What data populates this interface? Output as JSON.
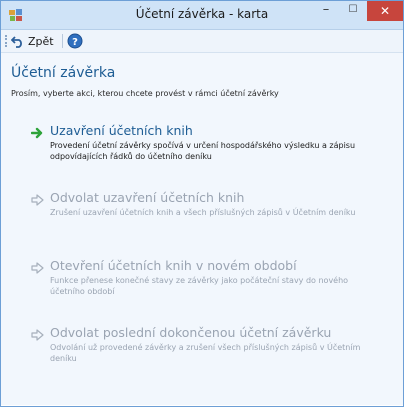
{
  "window": {
    "title": "Účetní závěrka - karta",
    "minimize_symbol": "–",
    "maximize_symbol": "☐",
    "close_symbol": "✕"
  },
  "toolbar": {
    "back_label": "Zpět",
    "back_icon": "undo-arrow-icon",
    "help_icon": "help-icon"
  },
  "page": {
    "title": "Účetní závěrka",
    "subtitle": "Prosím, vyberte akci, kterou chcete provést v rámci účetní závěrky"
  },
  "actions": [
    {
      "title": "Uzavření účetních knih",
      "description": "Provedení účetní závěrky spočívá v určení hospodářského výsledku a zápisu odpovídajících řádků do účetního deníku",
      "enabled": true,
      "icon": "green-arrow-icon"
    },
    {
      "title": "Odvolat uzavření účetních knih",
      "description": "Zrušení uzavření účetních knih a všech příslušných zápisů v Účetním deníku",
      "enabled": false,
      "icon": "gray-arrow-icon"
    },
    {
      "title": "Otevření účetních knih v novém období",
      "description": "Funkce přenese konečné stavy ze závěrky jako počáteční stavy do nového účetního období",
      "enabled": false,
      "icon": "gray-arrow-icon"
    },
    {
      "title": "Odvolat poslední dokončenou účetní závěrku",
      "description": "Odvolání už provedené závěrky a zrušení všech příslušných zápisů v Účetním deníku",
      "enabled": false,
      "icon": "gray-arrow-icon"
    }
  ],
  "colors": {
    "accent": "#1e5d94",
    "disabled": "#9aa4b2",
    "enabled_arrow": "#2ea33a",
    "close_button": "#c7453d"
  }
}
